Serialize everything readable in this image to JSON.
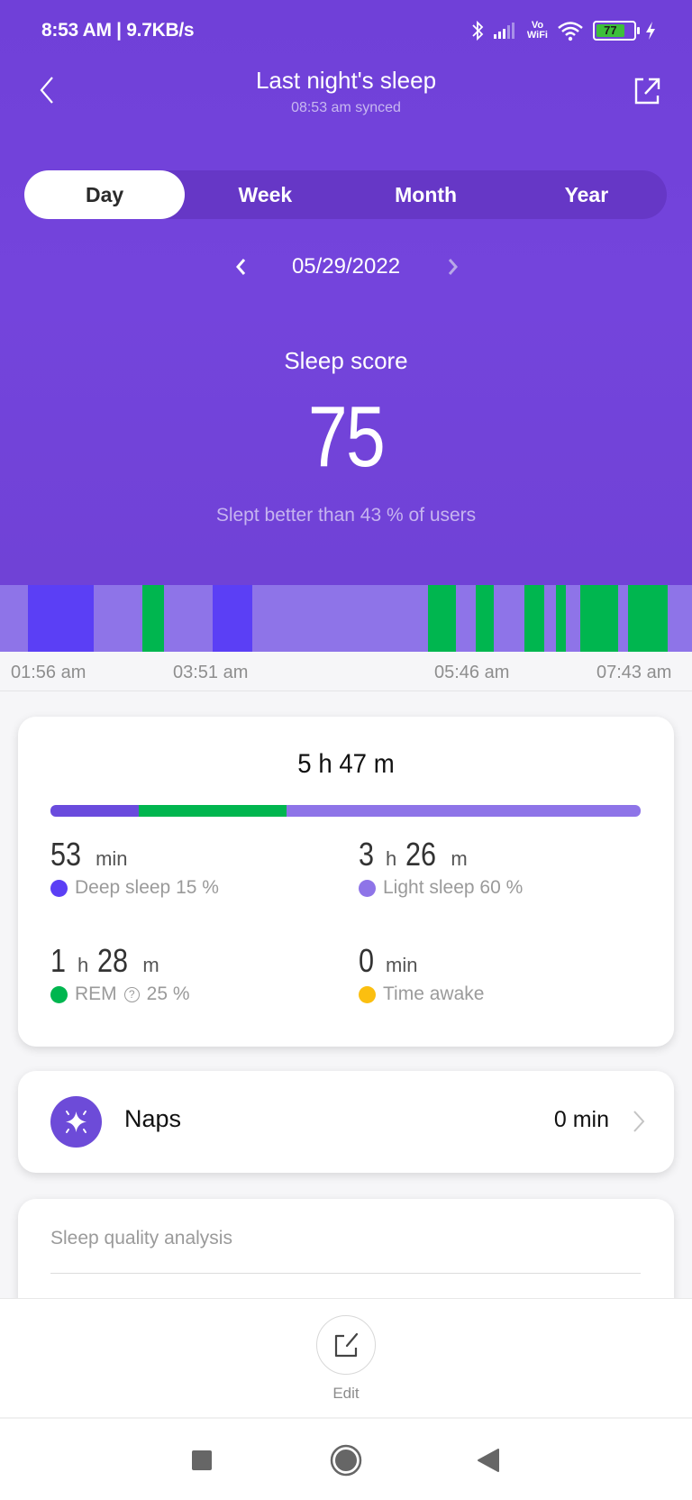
{
  "status_bar": {
    "time_speed": "8:53 AM | 9.7KB/s",
    "vowifi_top": "Vo",
    "vowifi_bottom": "WiFi",
    "battery_level": "77"
  },
  "header": {
    "title": "Last night's sleep",
    "subtitle": "08:53 am synced"
  },
  "tabs": [
    {
      "label": "Day",
      "active": true
    },
    {
      "label": "Week",
      "active": false
    },
    {
      "label": "Month",
      "active": false
    },
    {
      "label": "Year",
      "active": false
    }
  ],
  "date": "05/29/2022",
  "score": {
    "label": "Sleep score",
    "value": "75",
    "caption": "Slept better than 43 % of users"
  },
  "colors": {
    "deep": "#5b3ff5",
    "light": "#8e74e8",
    "rem": "#00b64f",
    "awake": "#fbbf10",
    "deep_bar": "#6a4bdd",
    "naps_icon": "#6d4bd8"
  },
  "hypnogram": {
    "start_label": "01:56 am",
    "axis_labels": [
      "01:56 am",
      "03:51 am",
      "05:46 am",
      "07:43 am"
    ],
    "segments": [
      {
        "stage": "light",
        "start": 0.0,
        "end": 0.04
      },
      {
        "stage": "deep",
        "start": 0.04,
        "end": 0.135
      },
      {
        "stage": "light",
        "start": 0.135,
        "end": 0.206
      },
      {
        "stage": "rem",
        "start": 0.206,
        "end": 0.237
      },
      {
        "stage": "light",
        "start": 0.237,
        "end": 0.307
      },
      {
        "stage": "deep",
        "start": 0.307,
        "end": 0.365
      },
      {
        "stage": "light",
        "start": 0.365,
        "end": 0.618
      },
      {
        "stage": "rem",
        "start": 0.618,
        "end": 0.659
      },
      {
        "stage": "light",
        "start": 0.659,
        "end": 0.688
      },
      {
        "stage": "rem",
        "start": 0.688,
        "end": 0.714
      },
      {
        "stage": "light",
        "start": 0.714,
        "end": 0.758
      },
      {
        "stage": "rem",
        "start": 0.758,
        "end": 0.786
      },
      {
        "stage": "light",
        "start": 0.786,
        "end": 0.803
      },
      {
        "stage": "rem",
        "start": 0.803,
        "end": 0.818
      },
      {
        "stage": "light",
        "start": 0.818,
        "end": 0.839
      },
      {
        "stage": "rem",
        "start": 0.839,
        "end": 0.893
      },
      {
        "stage": "light",
        "start": 0.893,
        "end": 0.908
      },
      {
        "stage": "rem",
        "start": 0.908,
        "end": 0.965
      },
      {
        "stage": "light",
        "start": 0.965,
        "end": 1.0
      }
    ]
  },
  "summary": {
    "total": "5 h 47 m",
    "distribution": [
      {
        "stage": "deep",
        "percent": 15
      },
      {
        "stage": "rem",
        "percent": 25
      },
      {
        "stage": "light",
        "percent": 60
      }
    ],
    "deep": {
      "num1": "53",
      "unit1": "min",
      "num2": "",
      "unit2": "",
      "label": "Deep sleep 15 %"
    },
    "light": {
      "num1": "3",
      "unit1": "h",
      "num2": "26",
      "unit2": "m",
      "label": "Light sleep 60 %"
    },
    "rem": {
      "num1": "1",
      "unit1": "h",
      "num2": "28",
      "unit2": "m",
      "label": "REM",
      "percent": "25 %",
      "help": "?"
    },
    "awake": {
      "num1": "0",
      "unit1": "min",
      "num2": "",
      "unit2": "",
      "label": "Time awake"
    }
  },
  "naps": {
    "label": "Naps",
    "value": "0 min"
  },
  "analysis": {
    "title": "Sleep quality analysis"
  },
  "bottom": {
    "edit_label": "Edit"
  }
}
